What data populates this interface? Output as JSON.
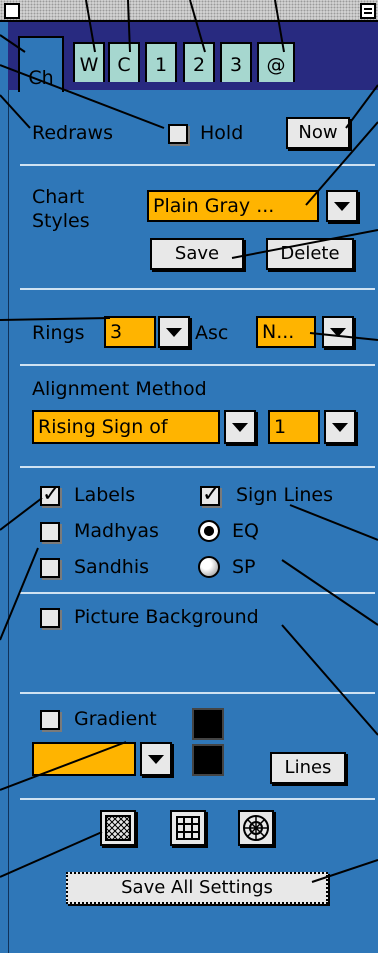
{
  "tabs": [
    {
      "label": "Ch",
      "active": true
    },
    {
      "label": "W",
      "active": false
    },
    {
      "label": "C",
      "active": false
    },
    {
      "label": "1",
      "active": false
    },
    {
      "label": "2",
      "active": false
    },
    {
      "label": "3",
      "active": false
    },
    {
      "label": "@",
      "active": false
    }
  ],
  "redraws": {
    "label": "Redraws",
    "hold_label": "Hold",
    "hold_checked": false,
    "now_label": "Now"
  },
  "chart_styles": {
    "label_line1": "Chart",
    "label_line2": "Styles",
    "selected": "Plain Gray ...",
    "save_label": "Save",
    "delete_label": "Delete"
  },
  "rings": {
    "label": "Rings",
    "value": "3",
    "asc_label": "Asc",
    "asc_value": "N..."
  },
  "alignment": {
    "heading": "Alignment Method",
    "method": "Rising Sign of",
    "number": "1"
  },
  "options": {
    "labels": {
      "label": "Labels",
      "checked": true
    },
    "sign_lines": {
      "label": "Sign Lines",
      "checked": true
    },
    "madhyas": {
      "label": "Madhyas",
      "checked": false
    },
    "eq": {
      "label": "EQ",
      "selected": true
    },
    "sandhis": {
      "label": "Sandhis",
      "checked": false
    },
    "sp": {
      "label": "SP",
      "selected": false
    }
  },
  "picture_background": {
    "label": "Picture Background",
    "checked": false
  },
  "gradient": {
    "label": "Gradient",
    "checked": false,
    "color": "#ffb400",
    "lines_label": "Lines"
  },
  "save_all_label": "Save All Settings",
  "colors": {
    "panel": "#2f77b8",
    "tab": "#a6d7cf",
    "popup": "#ffb400",
    "tabbar": "#282a80"
  },
  "icons": [
    "diamond-grid-icon",
    "square-grid-icon",
    "wheel-icon"
  ]
}
